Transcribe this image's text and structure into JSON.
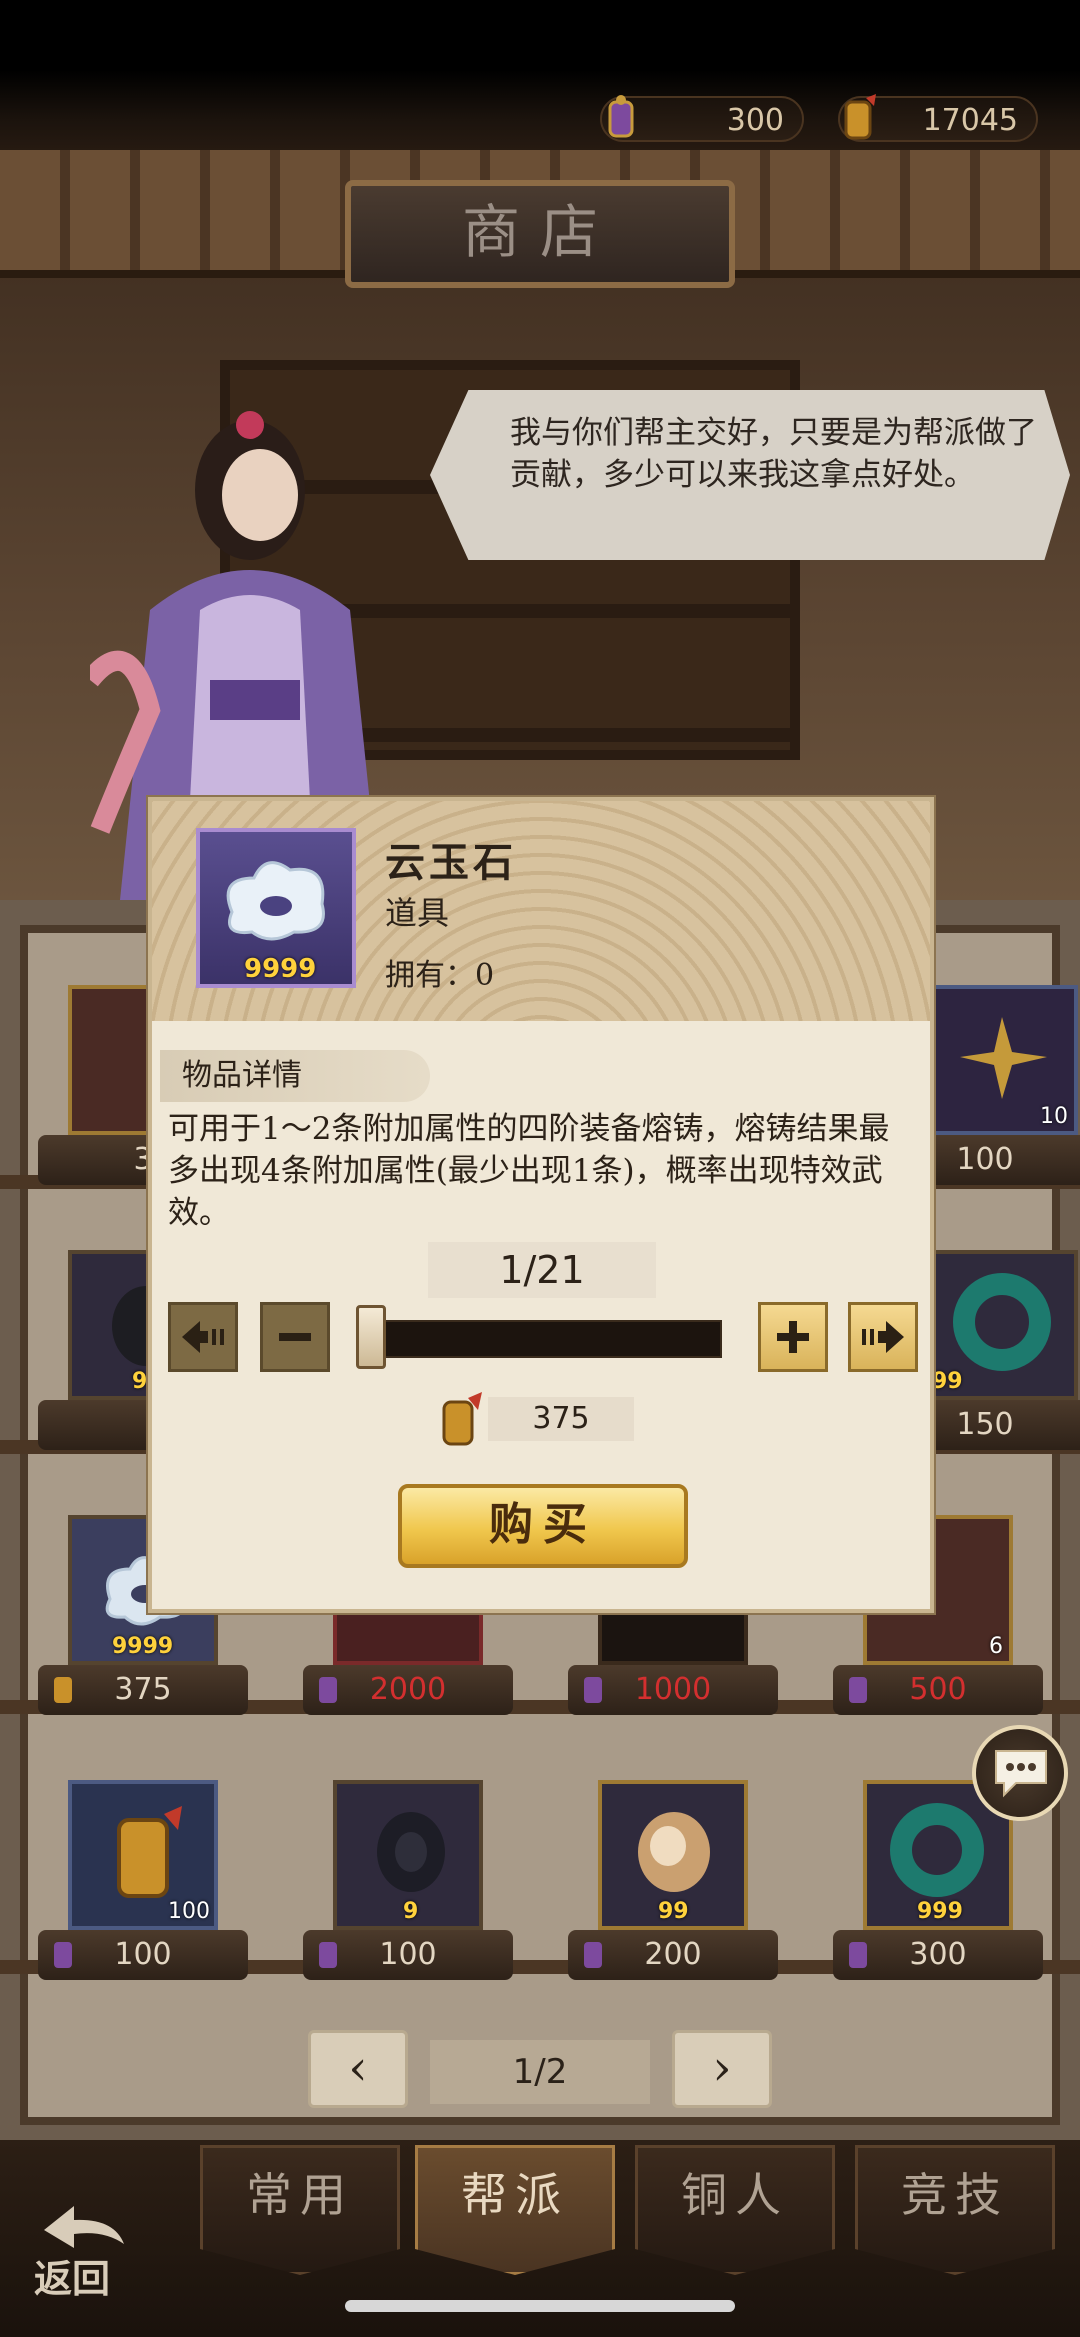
{
  "header": {
    "currency1_value": "300",
    "currency2_value": "17045",
    "shop_title": "商店"
  },
  "npc": {
    "speech": "我与你们帮主交好，只要是为帮派做了贡献，多少可以来我这拿点好处。"
  },
  "grid": {
    "row1": [
      {
        "price": "3",
        "qty": ""
      },
      {
        "price": "",
        "qty": ""
      },
      {
        "price": "",
        "qty": ""
      },
      {
        "price": "100",
        "qty": "10"
      }
    ],
    "row2": [
      {
        "price": "",
        "qty": "9"
      },
      {
        "price": "",
        "qty": ""
      },
      {
        "price": "",
        "qty": ""
      },
      {
        "price": "150",
        "qty": "99"
      }
    ],
    "row3": [
      {
        "price": "375",
        "qty": "9999"
      },
      {
        "price": "2000",
        "qty": ""
      },
      {
        "price": "1000",
        "qty": ""
      },
      {
        "price": "500",
        "qty": "6"
      }
    ],
    "row4": [
      {
        "price": "100",
        "qty": "100"
      },
      {
        "price": "100",
        "qty": "9"
      },
      {
        "price": "200",
        "qty": "99"
      },
      {
        "price": "300",
        "qty": "999"
      }
    ]
  },
  "pagination": {
    "prev": "‹",
    "label": "1/2",
    "next": "›"
  },
  "tabs": [
    "常用",
    "帮派",
    "铜人",
    "竞技"
  ],
  "back_label": "返回",
  "modal": {
    "item_name": "云玉石",
    "item_type": "道具",
    "owned": "拥有：0",
    "item_qty": "9999",
    "detail_tab": "物品详情",
    "description": "可用于1～2条附加属性的四阶装备熔铸，熔铸结果最多出现4条附加属性(最少出现1条)，概率出现特效武效。",
    "counter": "1/21",
    "slider_fraction": 0.0,
    "cost": "375",
    "buy_label": "购买"
  },
  "colors": {
    "price_red": "#d32f2f",
    "gold": "#f0c74d"
  }
}
